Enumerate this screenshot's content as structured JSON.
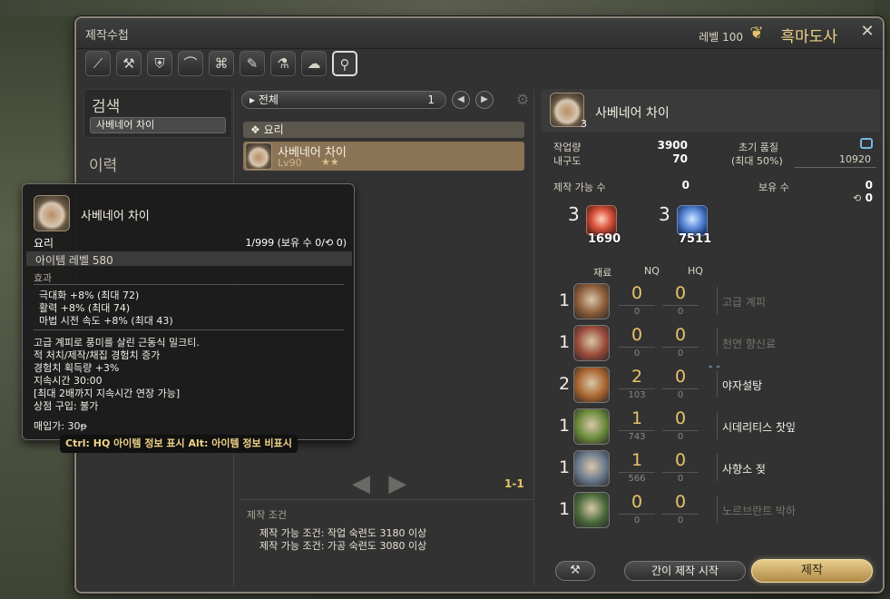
{
  "window": {
    "title": "제작수첩",
    "level": "레벨 100",
    "job": "흑마도사"
  },
  "class_bar": {
    "icons": [
      "carpenter-icon",
      "blacksmith-icon",
      "armorer-icon",
      "goldsmith-icon",
      "leatherworker-icon",
      "weaver-icon",
      "alchemist-icon",
      "culinarian-icon",
      "search-icon"
    ]
  },
  "search": {
    "title": "검색",
    "value": "사베네어 차이"
  },
  "history": {
    "title": "이력"
  },
  "list": {
    "filter": "▸ 전체",
    "filter_count": "1",
    "category": "❖ 요리",
    "recipe": {
      "name": "사베네어 차이",
      "level": "Lv90",
      "stars": "★★"
    },
    "page": "1-1"
  },
  "conditions": {
    "title": "제작 조건",
    "lines": [
      "제작 가능 조건: 작업 숙련도 3180 이상",
      "제작 가능 조건: 가공 숙련도 3080 이상"
    ]
  },
  "detail": {
    "item_name": "사베네어 차이",
    "yield": "3",
    "progress_label": "작업량",
    "progress": "3900",
    "durability_label": "내구도",
    "durability": "70",
    "initial_quality_label": "초기 품질",
    "max_quality_label": "(최대 50%)",
    "max_quality": "10920",
    "craftable_label": "제작 가능 수",
    "craftable": "0",
    "owned_label": "보유 수",
    "owned": "0",
    "owned_collectable": "0",
    "crystals": [
      {
        "qty": "3",
        "have": "1690",
        "type": "fire"
      },
      {
        "qty": "3",
        "have": "7511",
        "type": "water"
      }
    ],
    "mat_headers": {
      "mat": "재료",
      "nq": "NQ",
      "hq": "HQ"
    },
    "materials": [
      {
        "qty": "1",
        "name": "고급 계피",
        "nq": "0",
        "hq": "0",
        "nq_have": "0",
        "hq_have": "0",
        "dim": true,
        "color": "#8a5a36"
      },
      {
        "qty": "1",
        "name": "천연 향신료",
        "nq": "0",
        "hq": "0",
        "nq_have": "0",
        "hq_have": "0",
        "dim": true,
        "color": "#9a4a3a"
      },
      {
        "qty": "2",
        "name": "야자설탕",
        "nq": "2",
        "hq": "0",
        "nq_have": "103",
        "hq_have": "0",
        "dim": false,
        "color": "#a8642e"
      },
      {
        "qty": "1",
        "name": "시데리티스 찻잎",
        "nq": "1",
        "hq": "0",
        "nq_have": "743",
        "hq_have": "0",
        "dim": false,
        "color": "#6a8a3a"
      },
      {
        "qty": "1",
        "name": "사향소 젖",
        "nq": "1",
        "hq": "0",
        "nq_have": "566",
        "hq_have": "0",
        "dim": false,
        "color": "#6a7a8e"
      },
      {
        "qty": "1",
        "name": "노르브란트 박하",
        "nq": "0",
        "hq": "0",
        "nq_have": "0",
        "hq_have": "0",
        "dim": true,
        "color": "#4a6a3a"
      }
    ],
    "buttons": {
      "macro": "⚒",
      "quick_synth": "간이 제작 시작",
      "synth": "제작"
    }
  },
  "tooltip": {
    "name": "사베네어 차이",
    "category": "요리",
    "stock": "1/999 (보유 수 0/⟲ 0)",
    "item_level": "아이템 레벨 580",
    "effect_title": "효과",
    "effects": [
      "극대화 +8% (최대 72)",
      "활력 +8% (최대 74)",
      "마법 시전 속도 +8% (최대 43)"
    ],
    "desc": [
      "고급 계피로 풍미를 살린 근동식 밀크티.",
      "적 처치/제작/채집 경험치 증가",
      "경험치 획득량 +3%",
      "지속시간 30:00",
      "[최대 2배까지 지속시간 연장 가능]",
      "상점 구입: 불가"
    ],
    "price": "매입가: 30ᵽ",
    "hint": "Ctrl: HQ 아이템 정보 표시 Alt: 아이템 정보 비표시"
  }
}
